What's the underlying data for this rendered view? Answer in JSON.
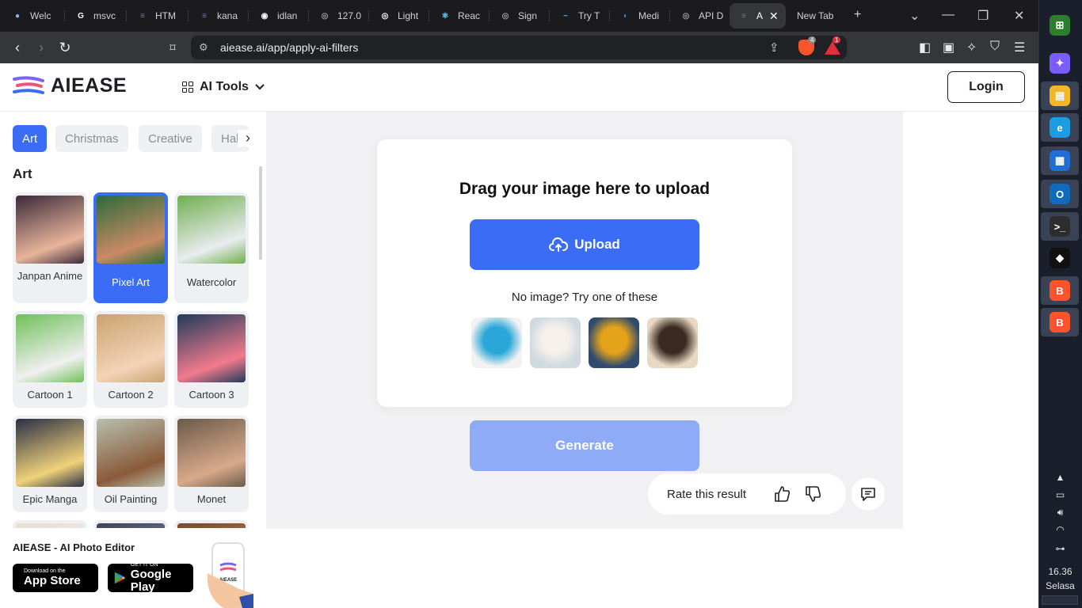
{
  "browser": {
    "tabs": [
      {
        "label": "Welc",
        "fav_color": "#8ab4f8",
        "fav_glyph": "●"
      },
      {
        "label": "msvc",
        "fav_color": "#ffffff",
        "fav_glyph": "G"
      },
      {
        "label": "HTM",
        "fav_color": "#7b61ff",
        "fav_glyph": "≡"
      },
      {
        "label": "kana",
        "fav_color": "#7b61ff",
        "fav_glyph": "≡"
      },
      {
        "label": "idlan",
        "fav_color": "#ffffff",
        "fav_glyph": "◉"
      },
      {
        "label": "127.0",
        "fav_color": "#9aa0a6",
        "fav_glyph": "◎"
      },
      {
        "label": "Light",
        "fav_color": "#ffffff",
        "fav_glyph": "◎"
      },
      {
        "label": "Reac",
        "fav_color": "#61dafb",
        "fav_glyph": "⚛"
      },
      {
        "label": "Sign",
        "fav_color": "#9aa0a6",
        "fav_glyph": "◎"
      },
      {
        "label": "Try T",
        "fav_color": "#38bdf8",
        "fav_glyph": "~"
      },
      {
        "label": "Medi",
        "fav_color": "#1e90ff",
        "fav_glyph": "◐"
      },
      {
        "label": "API D",
        "fav_color": "#9aa0a6",
        "fav_glyph": "◎"
      },
      {
        "label": "A",
        "fav_color": "#7b61ff",
        "fav_glyph": "≡"
      },
      {
        "label": "New Tab",
        "fav_color": "",
        "fav_glyph": ""
      }
    ],
    "url": "aiease.ai/app/apply-ai-filters",
    "shield_count": "4",
    "rewards_count": "1"
  },
  "header": {
    "logo_text": "AIEASE",
    "ai_tools_label": "AI Tools",
    "login_label": "Login"
  },
  "sidebar": {
    "chips": [
      "Art",
      "Christmas",
      "Creative",
      "Hal"
    ],
    "active_chip": "Art",
    "section_title": "Art",
    "cards": [
      {
        "label": "Janpan Anime",
        "c1": "#3b2a3a",
        "c2": "#e8b49a"
      },
      {
        "label": "Pixel Art",
        "c1": "#2e6b3c",
        "c2": "#c98a64"
      },
      {
        "label": "Watercolor",
        "c1": "#6fae4e",
        "c2": "#e9ecef"
      },
      {
        "label": "Cartoon 1",
        "c1": "#6fbf5a",
        "c2": "#f0f0f0"
      },
      {
        "label": "Cartoon 2",
        "c1": "#c9a36e",
        "c2": "#f3d3b8"
      },
      {
        "label": "Cartoon 3",
        "c1": "#1f3b5c",
        "c2": "#f27a8c"
      },
      {
        "label": "Epic Manga",
        "c1": "#2a2f45",
        "c2": "#f0d27a"
      },
      {
        "label": "Oil Painting",
        "c1": "#b7bfae",
        "c2": "#8a5a3a"
      },
      {
        "label": "Monet",
        "c1": "#6b5a4a",
        "c2": "#d8a98a"
      },
      {
        "label": "",
        "c1": "#e7ded4",
        "c2": "#f4ece4"
      },
      {
        "label": "",
        "c1": "#3b4453",
        "c2": "#7a8aa0"
      },
      {
        "label": "",
        "c1": "#7a4a2a",
        "c2": "#b57a4e"
      }
    ],
    "promo_title": "AIEASE - AI Photo Editor",
    "app_store_small": "Download on the",
    "app_store_big": "App Store",
    "google_play_small": "GET IT ON",
    "google_play_big": "Google Play",
    "phone_logo": "AIEASE"
  },
  "main": {
    "drag_title": "Drag your image here to upload",
    "upload_label": "Upload",
    "try_text": "No image? Try one of these",
    "samples": [
      {
        "name": "woman-curly-hair",
        "c1": "#f2f2f2",
        "c2": "#2aa7d8"
      },
      {
        "name": "wedding-couple",
        "c1": "#cfd9e0",
        "c2": "#f5f0ea"
      },
      {
        "name": "sunflowers",
        "c1": "#2f4c6e",
        "c2": "#e3a21a"
      },
      {
        "name": "dog-party-hat",
        "c1": "#e9d9c4",
        "c2": "#3a2a22"
      }
    ],
    "generate_label": "Generate",
    "rate_label": "Rate this result"
  },
  "taskbar": {
    "apps": [
      {
        "name": "start",
        "color": "#2c7d2c",
        "glyph": "⊞"
      },
      {
        "name": "copilot",
        "color": "#7a5cff",
        "glyph": "✦"
      },
      {
        "name": "file-explorer",
        "color": "#f2b824",
        "glyph": "▤"
      },
      {
        "name": "edge",
        "color": "#1b9de2",
        "glyph": "e"
      },
      {
        "name": "microsoft-store",
        "color": "#1f6fd6",
        "glyph": "▦"
      },
      {
        "name": "outlook",
        "color": "#0f6cbd",
        "glyph": "O"
      },
      {
        "name": "terminal",
        "color": "#2d2d2d",
        "glyph": ">_"
      },
      {
        "name": "cube-app",
        "color": "#111111",
        "glyph": "◆"
      },
      {
        "name": "brave",
        "color": "#fb542b",
        "glyph": "B"
      },
      {
        "name": "brave-2",
        "color": "#fb542b",
        "glyph": "B"
      }
    ],
    "time": "16.36",
    "day": "Selasa"
  }
}
